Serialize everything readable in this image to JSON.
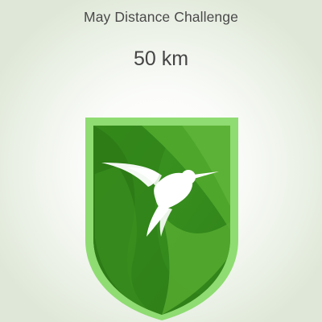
{
  "challenge": {
    "title": "May Distance Challenge",
    "distance_value": "50 km"
  },
  "badge": {
    "icon": "hummingbird-icon",
    "colors": {
      "border": "#8fdc72",
      "dark": "#2f7f17",
      "mid": "#3f9a22",
      "light": "#5cae34",
      "bird": "#ffffff"
    }
  }
}
